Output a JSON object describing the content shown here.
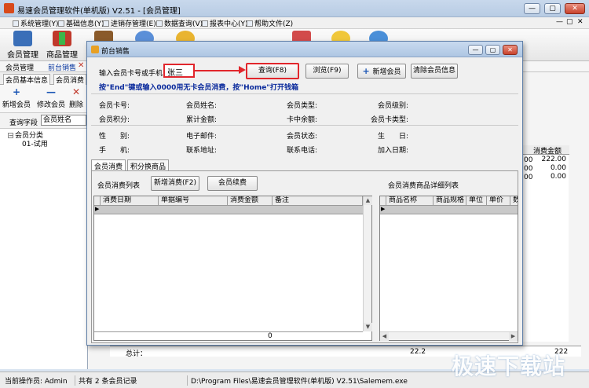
{
  "window": {
    "title": "易速会员管理软件(单机版) V2.51 - [会员管理]",
    "buttons": {
      "min": "—",
      "max": "▢",
      "close": "✕"
    }
  },
  "menubar": {
    "items": [
      "系统管理(Y)",
      "基础信息(Y)",
      "进销存管理(E)",
      "数据查询(V)",
      "报表中心(Y)",
      "帮助文件(Z)"
    ],
    "right": {
      "min": "—",
      "max": "▢",
      "close": "✕"
    }
  },
  "toolbar": {
    "items": [
      "会员管理",
      "商品管理"
    ]
  },
  "subtabs": {
    "items": [
      "会员管理",
      "前台销售"
    ]
  },
  "leftpanel": {
    "tabs": [
      "会员基本信息",
      "会员消费"
    ],
    "tools": [
      "新增会员",
      "修改会员",
      "删除"
    ],
    "search_label": "查询字段",
    "search_field": "会员姓名",
    "tree_root": "会员分类",
    "tree_child": "01-试用"
  },
  "bg_grid": {
    "header": "消费金额",
    "values": [
      "222.00",
      "0.00",
      "0.00"
    ],
    "left_values": [
      "00",
      "00",
      "00"
    ],
    "footer_label": "总计：",
    "footer_value": "22.2",
    "footer_right": "222"
  },
  "status": {
    "operator": "当前操作员: Admin",
    "records": "共有 2 条会员记录",
    "path": "D:\\Program Files\\易速会员管理软件(单机版) V2.51\\Salemem.exe"
  },
  "watermark": "极速下载站",
  "dialog": {
    "title": "前台销售",
    "card_label": "输入会员卡号或手机",
    "card_value": "张三",
    "query_button": "查询(F8)",
    "browse_button": "浏览(F9)",
    "add_member_button": "新增会员",
    "clear_button": "清除会员信息",
    "hint": "按\"End\"键或输入0000用无卡会员消费，按\"Home\"打开钱箱",
    "info_row1": [
      "会员卡号:",
      "会员姓名:",
      "会员类型:",
      "会员级别:"
    ],
    "info_row2": [
      "会员积分:",
      "累计金额:",
      "卡中余额:",
      "会员卡类型:"
    ],
    "info_row3": [
      "性　　别:",
      "电子邮件:",
      "会员状态:",
      "生　　日:"
    ],
    "info_row4": [
      "手　　机:",
      "联系地址:",
      "联系电话:",
      "加入日期:"
    ],
    "tabs": [
      "会员消费",
      "积分换商品"
    ],
    "consume_list_label": "会员消费列表",
    "new_consume_button": "新增消费(F2)",
    "renew_button": "会员续费",
    "detail_list_label": "会员消费商品详细列表",
    "left_grid": {
      "columns": [
        "消费日期",
        "单据编号",
        "消费金额",
        "备注"
      ],
      "footer_value": "0"
    },
    "right_grid": {
      "columns": [
        "商品名称",
        "商品规格",
        "单位",
        "单价",
        "数"
      ]
    }
  }
}
